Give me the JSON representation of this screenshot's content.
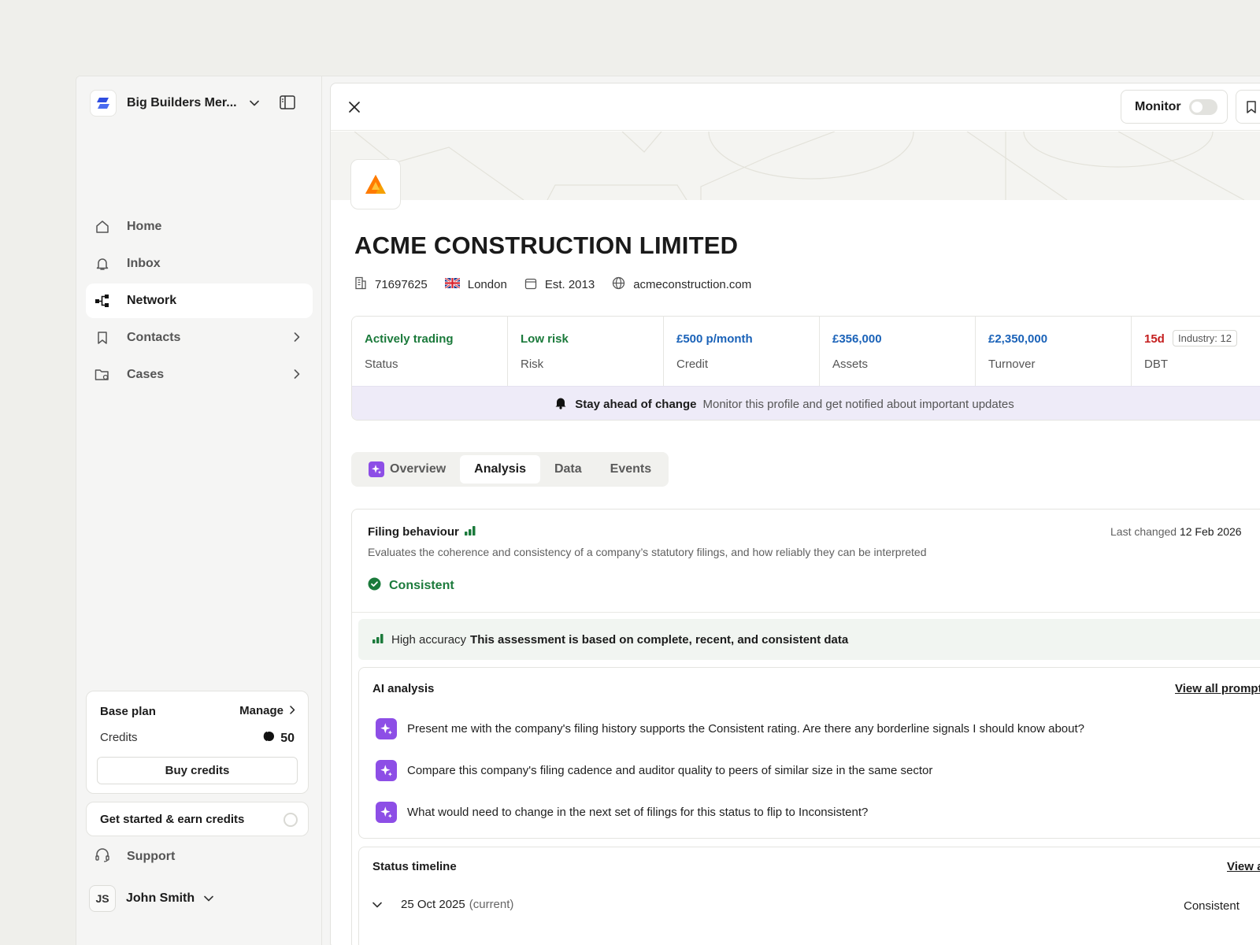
{
  "sidebar": {
    "org_name": "Big Builders Mer...",
    "nav": [
      {
        "label": "Home",
        "icon": "home-icon"
      },
      {
        "label": "Inbox",
        "icon": "bell-icon"
      },
      {
        "label": "Network",
        "icon": "network-icon",
        "active": true
      },
      {
        "label": "Contacts",
        "icon": "bookmark-icon",
        "has_arrow": true
      },
      {
        "label": "Cases",
        "icon": "folder-icon",
        "has_arrow": true
      }
    ],
    "plan": {
      "title": "Base plan",
      "manage_label": "Manage",
      "credits_label": "Credits",
      "credits_value": "50",
      "buy_label": "Buy credits"
    },
    "get_started_label": "Get started & earn credits",
    "support_label": "Support",
    "user": {
      "initials": "JS",
      "name": "John Smith"
    }
  },
  "topbar": {
    "monitor_label": "Monitor",
    "monitor_on": false
  },
  "company": {
    "name": "ACME CONSTRUCTION LIMITED",
    "number": "71697625",
    "location": "London",
    "established": "Est. 2013",
    "website": "acmeconstruction.com"
  },
  "stats": [
    {
      "value": "Actively trading",
      "label": "Status",
      "tone": "green"
    },
    {
      "value": "Low risk",
      "label": "Risk",
      "tone": "green"
    },
    {
      "value": "£500 p/month",
      "label": "Credit",
      "tone": "blue"
    },
    {
      "value": "£356,000",
      "label": "Assets",
      "tone": "blue"
    },
    {
      "value": "£2,350,000",
      "label": "Turnover",
      "tone": "blue"
    },
    {
      "value": "15d",
      "label": "DBT",
      "tone": "red",
      "chip": "Industry: 12"
    }
  ],
  "notify": {
    "bold": "Stay ahead of change",
    "text": "Monitor this profile and get notified about important updates"
  },
  "tabs": [
    {
      "label": "Overview",
      "ai": true
    },
    {
      "label": "Analysis",
      "active": true
    },
    {
      "label": "Data"
    },
    {
      "label": "Events"
    }
  ],
  "analysis": {
    "title": "Filing behaviour",
    "description": "Evaluates the coherence and consistency of a company’s statutory filings, and how reliably they can be interpreted",
    "last_changed_label": "Last changed",
    "last_changed_value": "12 Feb 2026",
    "status": "Consistent",
    "accuracy_label": "High accuracy",
    "accuracy_text": "This assessment is based on complete, recent, and consistent data",
    "ai_title": "AI analysis",
    "view_all": "View all prompts",
    "prompts": [
      "Present me with the company's filing history supports the Consistent rating. Are there any borderline signals I should know about?",
      "Compare this company's filing cadence and auditor quality to peers of similar size in the same sector",
      "What would need to change in the next set of filings for this status to flip to Inconsistent?"
    ],
    "timeline_title": "Status timeline",
    "timeline_view": "View all",
    "timeline_rows": [
      {
        "date": "25 Oct 2025",
        "note": "(current)",
        "status": "Consistent"
      }
    ]
  },
  "colors": {
    "accent_purple": "#8d4ee6",
    "positive_green": "#1b7a3b",
    "money_blue": "#1a62b8",
    "alert_red": "#c41e1e",
    "brand_blue": "#2f4de0",
    "logo_orange": "#f5a000"
  }
}
